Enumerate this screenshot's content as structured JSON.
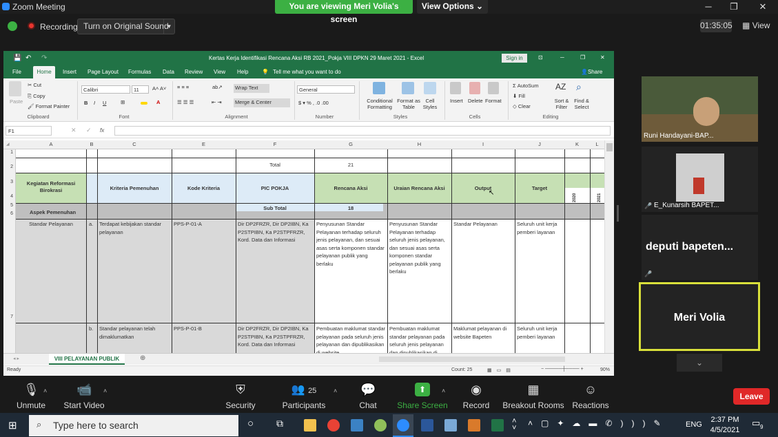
{
  "zoom": {
    "window_title": "Zoom Meeting",
    "viewing_banner": "You are viewing Meri Volia's screen",
    "view_options": "View Options ⌄",
    "recording_label": "Recording",
    "original_sound": "Turn on Original Sound",
    "timer": "01:35:05",
    "view_label": "View",
    "participants_count": "25",
    "toolbar": [
      {
        "label": "Unmute"
      },
      {
        "label": "Start Video"
      },
      {
        "label": "Security"
      },
      {
        "label": "Participants"
      },
      {
        "label": "Chat"
      },
      {
        "label": "Share Screen"
      },
      {
        "label": "Record"
      },
      {
        "label": "Breakout Rooms"
      },
      {
        "label": "Reactions"
      }
    ],
    "leave_label": "Leave",
    "tiles": [
      {
        "name": "Runi Handayani-BAP..."
      },
      {
        "name": "E_Kunarsih BAPET..."
      },
      {
        "name": "deputi  bapeten..."
      },
      {
        "name": "Meri Volia"
      }
    ]
  },
  "excel": {
    "title": "Kertas Kerja Identifikasi Rencana Aksi RB 2021_Pokja VIII DPKN 29 Maret 2021  -  Excel",
    "sign_in": "Sign in",
    "tabs": [
      "File",
      "Home",
      "Insert",
      "Page Layout",
      "Formulas",
      "Data",
      "Review",
      "View",
      "Help"
    ],
    "tell_me": "Tell me what you want to do",
    "share": "Share",
    "ribbon": {
      "cut": "Cut",
      "copy": "Copy",
      "format_painter": "Format Painter",
      "paste": "Paste",
      "font_name": "Calibri",
      "font_size": "11",
      "wrap_text": "Wrap Text",
      "merge_center": "Merge & Center",
      "number_format": "General",
      "conditional": "Conditional",
      "formatting": "Formatting",
      "format_as": "Format as",
      "table": "Table",
      "cell": "Cell",
      "styles": "Styles",
      "insert": "Insert",
      "delete": "Delete",
      "format": "Format",
      "autosum": "AutoSum",
      "fill": "Fill",
      "clear": "Clear",
      "sort": "Sort &",
      "filter": "Filter",
      "find": "Find &",
      "select": "Select",
      "groups": [
        "Clipboard",
        "Font",
        "Alignment",
        "Number",
        "Styles",
        "Cells",
        "Editing"
      ]
    },
    "name_box": "F1",
    "columns": [
      "A",
      "B",
      "C",
      "E",
      "F",
      "G",
      "H",
      "I",
      "J",
      "K",
      "L"
    ],
    "rows": [
      "1",
      "2",
      "3",
      "4",
      "5",
      "6",
      "7"
    ],
    "cells": {
      "total_label": "Total",
      "total_value": "21",
      "h_kegiatan": "Kegiatan Reformasi Birokrasi",
      "h_kriteria": "Kriteria Pemenuhan",
      "h_kode": "Kode Kriteria",
      "h_pic": "PIC POKJA",
      "h_rencana": "Rencana Aksi",
      "h_uraian": "Uraian Rencana Aksi",
      "h_output": "Output",
      "h_target": "Target",
      "h_2020": "2020",
      "h_2021": "2021",
      "aspek": "Aspek Pemenuhan",
      "subtotal_label": "Sub Total",
      "subtotal_value": "18",
      "standar": "Standar Pelayanan",
      "a": "a.",
      "a_kriteria": "Terdapat kebijakan standar pelayanan",
      "a_kode": "PPS-P-01-A",
      "a_pic": "Dir DP2FRZR, Dir DP2IBN, Ka P2STPIBN, Ka P2STPFRZR, Kord. Data dan Informasi",
      "a_rencana": "Penyusunan Standar Pelayanan terhadap seluruh jenis pelayanan, dan sesuai asas serta komponen standar pelayanan publik yang berlaku",
      "a_uraian": "Penyusunan Standar Pelayanan terhadap seluruh jenis pelayanan, dan sesuai asas serta komponen standar pelayanan publik yang berlaku",
      "a_output": "Standar Pelayanan",
      "a_target": "Seluruh unit kerja pemberi layanan",
      "b": "b.",
      "b_kriteria": "Standar pelayanan telah dimaklumatkan",
      "b_kode": "PPS-P-01-B",
      "b_pic": "Dir DP2FRZR, Dir DP2IBN, Ka P2STPIBN, Ka P2STPFRZR, Kord. Data dan Informasi",
      "b_rencana": "Pembuatan maklumat standar pelayanan pada seluruh jenis pelayanan dan dipublikasikan di website",
      "b_uraian": "Pembuatan maklumat standar pelayanan pada seluruh jenis pelayanan dan dipublikasikan di",
      "b_output": "Maklumat pelayanan di website Bapeten",
      "b_target": "Seluruh unit kerja pemberi layanan"
    },
    "sheet_tab": "VIII PELAYANAN PUBLIK",
    "status_ready": "Ready",
    "status_count": "Count: 25",
    "zoom_level": "90%"
  },
  "taskbar": {
    "search_placeholder": "Type here to search",
    "lang": "ENG",
    "time": "2:37 PM",
    "date": "4/5/2021",
    "notif_count": "9"
  },
  "colors": {
    "excel_green": "#217346",
    "zoom_green": "#3cb043",
    "header_green": "#c6e0b4",
    "header_blue": "#ddebf7",
    "leave_red": "#e02828",
    "speaker_border": "#d9e03a"
  }
}
